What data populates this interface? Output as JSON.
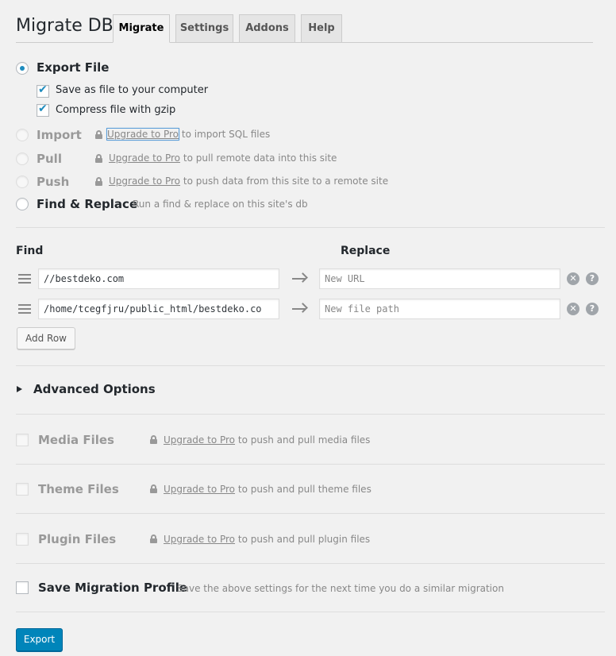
{
  "header": {
    "title": "Migrate DB",
    "tabs": [
      {
        "label": "Migrate",
        "active": true
      },
      {
        "label": "Settings",
        "active": false
      },
      {
        "label": "Addons",
        "active": false
      },
      {
        "label": "Help",
        "active": false
      }
    ]
  },
  "options": {
    "export": {
      "label": "Export File",
      "selected": true,
      "save_as_file": {
        "label": "Save as file to your computer",
        "checked": true
      },
      "compress": {
        "label": "Compress file with gzip",
        "checked": true
      }
    },
    "import": {
      "label": "Import",
      "link": "Upgrade to Pro",
      "hint": "to import SQL files",
      "disabled": true
    },
    "pull": {
      "label": "Pull",
      "link": "Upgrade to Pro",
      "hint": "to pull remote data into this site",
      "disabled": true
    },
    "push": {
      "label": "Push",
      "link": "Upgrade to Pro",
      "hint": "to push data from this site to a remote site",
      "disabled": true
    },
    "find_replace": {
      "label": "Find & Replace",
      "hint": "Run a find & replace on this site's db",
      "selected": false
    }
  },
  "find_replace": {
    "find_heading": "Find",
    "replace_heading": "Replace",
    "rows": [
      {
        "find": "//bestdeko.com",
        "replace_value": "",
        "replace_placeholder": "New URL"
      },
      {
        "find": "/home/tcegfjru/public_html/bestdeko.co",
        "replace_value": "",
        "replace_placeholder": "New file path"
      }
    ],
    "remove_icon": "close-circle-icon",
    "help_icon": "help-circle-icon",
    "help_symbol": "?",
    "remove_symbol": "✕",
    "add_row_label": "Add Row"
  },
  "advanced": {
    "label": "Advanced Options",
    "expanded": false
  },
  "files": {
    "media": {
      "label": "Media Files",
      "link": "Upgrade to Pro",
      "hint": "to push and pull media files"
    },
    "theme": {
      "label": "Theme Files",
      "link": "Upgrade to Pro",
      "hint": "to push and pull theme files"
    },
    "plugin": {
      "label": "Plugin Files",
      "link": "Upgrade to Pro",
      "hint": "to push and pull plugin files"
    }
  },
  "profile": {
    "label": "Save Migration Profile",
    "hint": "Save the above settings for the next time you do a similar migration",
    "checked": false
  },
  "export_button": "Export",
  "colors": {
    "accent": "#0085ba",
    "radio_dot": "#1e8cbe",
    "background": "#f1f1f1"
  }
}
